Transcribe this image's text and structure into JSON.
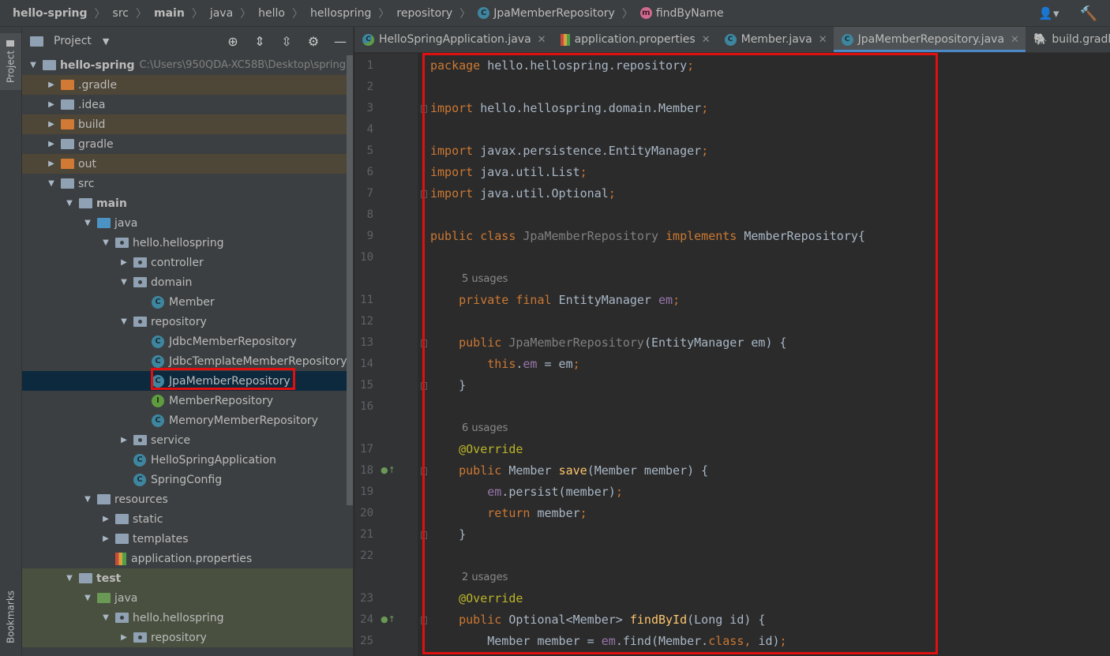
{
  "breadcrumb": [
    {
      "label": "hello-spring",
      "bold": true
    },
    {
      "label": "src"
    },
    {
      "label": "main",
      "bold": true
    },
    {
      "label": "java"
    },
    {
      "label": "hello"
    },
    {
      "label": "hellospring"
    },
    {
      "label": "repository"
    },
    {
      "label": "JpaMemberRepository",
      "icon": "C"
    },
    {
      "label": "findByName",
      "icon": "m"
    }
  ],
  "toolstrip": {
    "project_label": "Project",
    "bookmarks_label": "Bookmarks"
  },
  "project_panel": {
    "title": "Project",
    "tree": [
      {
        "label": "hello-spring",
        "depth": 0,
        "arrow": "down",
        "icon": "module",
        "bold": true,
        "path": "C:\\Users\\950QDA-XC58B\\Desktop\\spring"
      },
      {
        "label": ".gradle",
        "depth": 1,
        "arrow": "right",
        "icon": "folder-orange",
        "bg": "excluded"
      },
      {
        "label": ".idea",
        "depth": 1,
        "arrow": "right",
        "icon": "folder"
      },
      {
        "label": "build",
        "depth": 1,
        "arrow": "right",
        "icon": "folder-orange",
        "bg": "excluded"
      },
      {
        "label": "gradle",
        "depth": 1,
        "arrow": "right",
        "icon": "folder"
      },
      {
        "label": "out",
        "depth": 1,
        "arrow": "right",
        "icon": "folder-orange",
        "bg": "excluded"
      },
      {
        "label": "src",
        "depth": 1,
        "arrow": "down",
        "icon": "folder"
      },
      {
        "label": "main",
        "depth": 2,
        "arrow": "down",
        "icon": "folder",
        "bold": true
      },
      {
        "label": "java",
        "depth": 3,
        "arrow": "down",
        "icon": "folder-blue"
      },
      {
        "label": "hello.hellospring",
        "depth": 4,
        "arrow": "down",
        "icon": "package"
      },
      {
        "label": "controller",
        "depth": 5,
        "arrow": "right",
        "icon": "package"
      },
      {
        "label": "domain",
        "depth": 5,
        "arrow": "down",
        "icon": "package"
      },
      {
        "label": "Member",
        "depth": 6,
        "arrow": "",
        "icon": "class"
      },
      {
        "label": "repository",
        "depth": 5,
        "arrow": "down",
        "icon": "package"
      },
      {
        "label": "JdbcMemberRepository",
        "depth": 6,
        "arrow": "",
        "icon": "class"
      },
      {
        "label": "JdbcTemplateMemberRepository",
        "depth": 6,
        "arrow": "",
        "icon": "class"
      },
      {
        "label": "JpaMemberRepository",
        "depth": 6,
        "arrow": "",
        "icon": "class",
        "bg": "selected"
      },
      {
        "label": "MemberRepository",
        "depth": 6,
        "arrow": "",
        "icon": "interface"
      },
      {
        "label": "MemoryMemberRepository",
        "depth": 6,
        "arrow": "",
        "icon": "class"
      },
      {
        "label": "service",
        "depth": 5,
        "arrow": "right",
        "icon": "package"
      },
      {
        "label": "HelloSpringApplication",
        "depth": 5,
        "arrow": "",
        "icon": "app"
      },
      {
        "label": "SpringConfig",
        "depth": 5,
        "arrow": "",
        "icon": "class"
      },
      {
        "label": "resources",
        "depth": 3,
        "arrow": "down",
        "icon": "folder"
      },
      {
        "label": "static",
        "depth": 4,
        "arrow": "right",
        "icon": "folder"
      },
      {
        "label": "templates",
        "depth": 4,
        "arrow": "right",
        "icon": "folder"
      },
      {
        "label": "application.properties",
        "depth": 4,
        "arrow": "",
        "icon": "properties"
      },
      {
        "label": "test",
        "depth": 2,
        "arrow": "down",
        "icon": "folder",
        "bold": true,
        "bg": "test"
      },
      {
        "label": "java",
        "depth": 3,
        "arrow": "down",
        "icon": "folder-green",
        "bg": "test"
      },
      {
        "label": "hello.hellospring",
        "depth": 4,
        "arrow": "down",
        "icon": "package",
        "bg": "test"
      },
      {
        "label": "repository",
        "depth": 5,
        "arrow": "right",
        "icon": "package",
        "bg": "test"
      }
    ]
  },
  "tabs": [
    {
      "label": "HelloSpringApplication.java",
      "icon": "app",
      "close": "✕"
    },
    {
      "label": "application.properties",
      "icon": "properties",
      "close": "✕"
    },
    {
      "label": "Member.java",
      "icon": "class",
      "close": "✕"
    },
    {
      "label": "JpaMemberRepository.java",
      "icon": "class",
      "close": "✕",
      "active": true
    },
    {
      "label": "build.gradle (hello-spring)",
      "icon": "gradle",
      "close": ""
    }
  ],
  "editor": {
    "lines": [
      {
        "n": "1",
        "t": [
          [
            "kw",
            "package "
          ],
          [
            "",
            "hello.hellospring.repository"
          ],
          [
            "kw",
            ";"
          ]
        ]
      },
      {
        "n": "2",
        "t": []
      },
      {
        "n": "3",
        "t": [
          [
            "kw",
            "import "
          ],
          [
            "",
            "hello.hellospring.domain.Member"
          ],
          [
            "kw",
            ";"
          ]
        ],
        "fold": true
      },
      {
        "n": "4",
        "t": []
      },
      {
        "n": "5",
        "t": [
          [
            "kw",
            "import "
          ],
          [
            "",
            "javax.persistence.EntityManager"
          ],
          [
            "kw",
            ";"
          ]
        ]
      },
      {
        "n": "6",
        "t": [
          [
            "kw",
            "import "
          ],
          [
            "",
            "java.util.List"
          ],
          [
            "kw",
            ";"
          ]
        ]
      },
      {
        "n": "7",
        "t": [
          [
            "kw",
            "import "
          ],
          [
            "",
            "java.util.Optional"
          ],
          [
            "kw",
            ";"
          ]
        ],
        "fold": true
      },
      {
        "n": "8",
        "t": []
      },
      {
        "n": "9",
        "t": [
          [
            "kw",
            "public class "
          ],
          [
            "cls-dim",
            "JpaMemberRepository "
          ],
          [
            "kw",
            "implements "
          ],
          [
            "",
            "MemberRepository{"
          ]
        ]
      },
      {
        "n": "10",
        "t": []
      },
      {
        "usage": "5 usages"
      },
      {
        "n": "11",
        "t": [
          [
            "",
            "    "
          ],
          [
            "kw",
            "private final "
          ],
          [
            "",
            "EntityManager "
          ],
          [
            "fld",
            "em"
          ],
          [
            "kw",
            ";"
          ]
        ]
      },
      {
        "n": "12",
        "t": []
      },
      {
        "n": "13",
        "t": [
          [
            "",
            "    "
          ],
          [
            "kw",
            "public "
          ],
          [
            "cls-dim",
            "JpaMemberRepository"
          ],
          [
            "",
            "(EntityManager em) {"
          ]
        ],
        "fold": true
      },
      {
        "n": "14",
        "t": [
          [
            "",
            "        "
          ],
          [
            "kw",
            "this"
          ],
          [
            "",
            "."
          ],
          [
            "fld",
            "em"
          ],
          [
            "",
            " = em"
          ],
          [
            "kw",
            ";"
          ]
        ]
      },
      {
        "n": "15",
        "t": [
          [
            "",
            "    }"
          ]
        ],
        "fold": true
      },
      {
        "n": "16",
        "t": []
      },
      {
        "usage": "6 usages"
      },
      {
        "n": "17",
        "t": [
          [
            "",
            "    "
          ],
          [
            "ann",
            "@Override"
          ]
        ]
      },
      {
        "n": "18",
        "t": [
          [
            "",
            "    "
          ],
          [
            "kw",
            "public "
          ],
          [
            "",
            "Member "
          ],
          [
            "fn",
            "save"
          ],
          [
            "",
            "(Member member) {"
          ]
        ],
        "fold": true,
        "mark": true
      },
      {
        "n": "19",
        "t": [
          [
            "",
            "        "
          ],
          [
            "fld",
            "em"
          ],
          [
            "",
            ".persist(member)"
          ],
          [
            "kw",
            ";"
          ]
        ]
      },
      {
        "n": "20",
        "t": [
          [
            "",
            "        "
          ],
          [
            "kw",
            "return "
          ],
          [
            "",
            "member"
          ],
          [
            "kw",
            ";"
          ]
        ]
      },
      {
        "n": "21",
        "t": [
          [
            "",
            "    }"
          ]
        ],
        "fold": true
      },
      {
        "n": "22",
        "t": []
      },
      {
        "usage": "2 usages"
      },
      {
        "n": "23",
        "t": [
          [
            "",
            "    "
          ],
          [
            "ann",
            "@Override"
          ]
        ]
      },
      {
        "n": "24",
        "t": [
          [
            "",
            "    "
          ],
          [
            "kw",
            "public "
          ],
          [
            "",
            "Optional<Member> "
          ],
          [
            "fn",
            "findById"
          ],
          [
            "",
            "(Long id) {"
          ]
        ],
        "fold": true,
        "mark": true
      },
      {
        "n": "25",
        "t": [
          [
            "",
            "        Member member = "
          ],
          [
            "fld",
            "em"
          ],
          [
            "",
            ".find(Member."
          ],
          [
            "kw",
            "class, "
          ],
          [
            "",
            "id)"
          ],
          [
            "kw",
            ";"
          ]
        ]
      }
    ]
  }
}
